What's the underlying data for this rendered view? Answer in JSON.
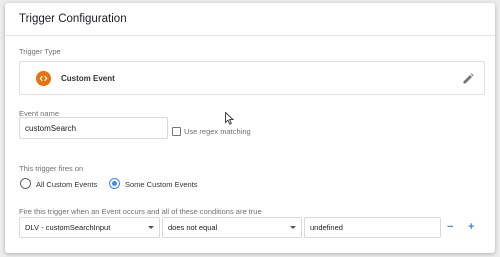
{
  "header": {
    "title": "Trigger Configuration"
  },
  "trigger_type": {
    "label": "Trigger Type",
    "name": "Custom Event",
    "icon": "custom-event-icon",
    "edit_icon": "pencil-icon"
  },
  "event_name": {
    "label": "Event name",
    "value": "customSearch",
    "regex_label": "Use regex matching"
  },
  "fires_on": {
    "label": "This trigger fires on",
    "options": [
      "All Custom Events",
      "Some Custom Events"
    ],
    "selected": "Some Custom Events"
  },
  "conditions": {
    "label": "Fire this trigger when an Event occurs and all of these conditions are true",
    "variable": "DLV - customSearchInput",
    "operator": "does not equal",
    "value": "undefined",
    "remove_label": "−",
    "add_label": "+"
  },
  "colors": {
    "accent": "#4285f4",
    "event_icon": "#e8710a"
  }
}
